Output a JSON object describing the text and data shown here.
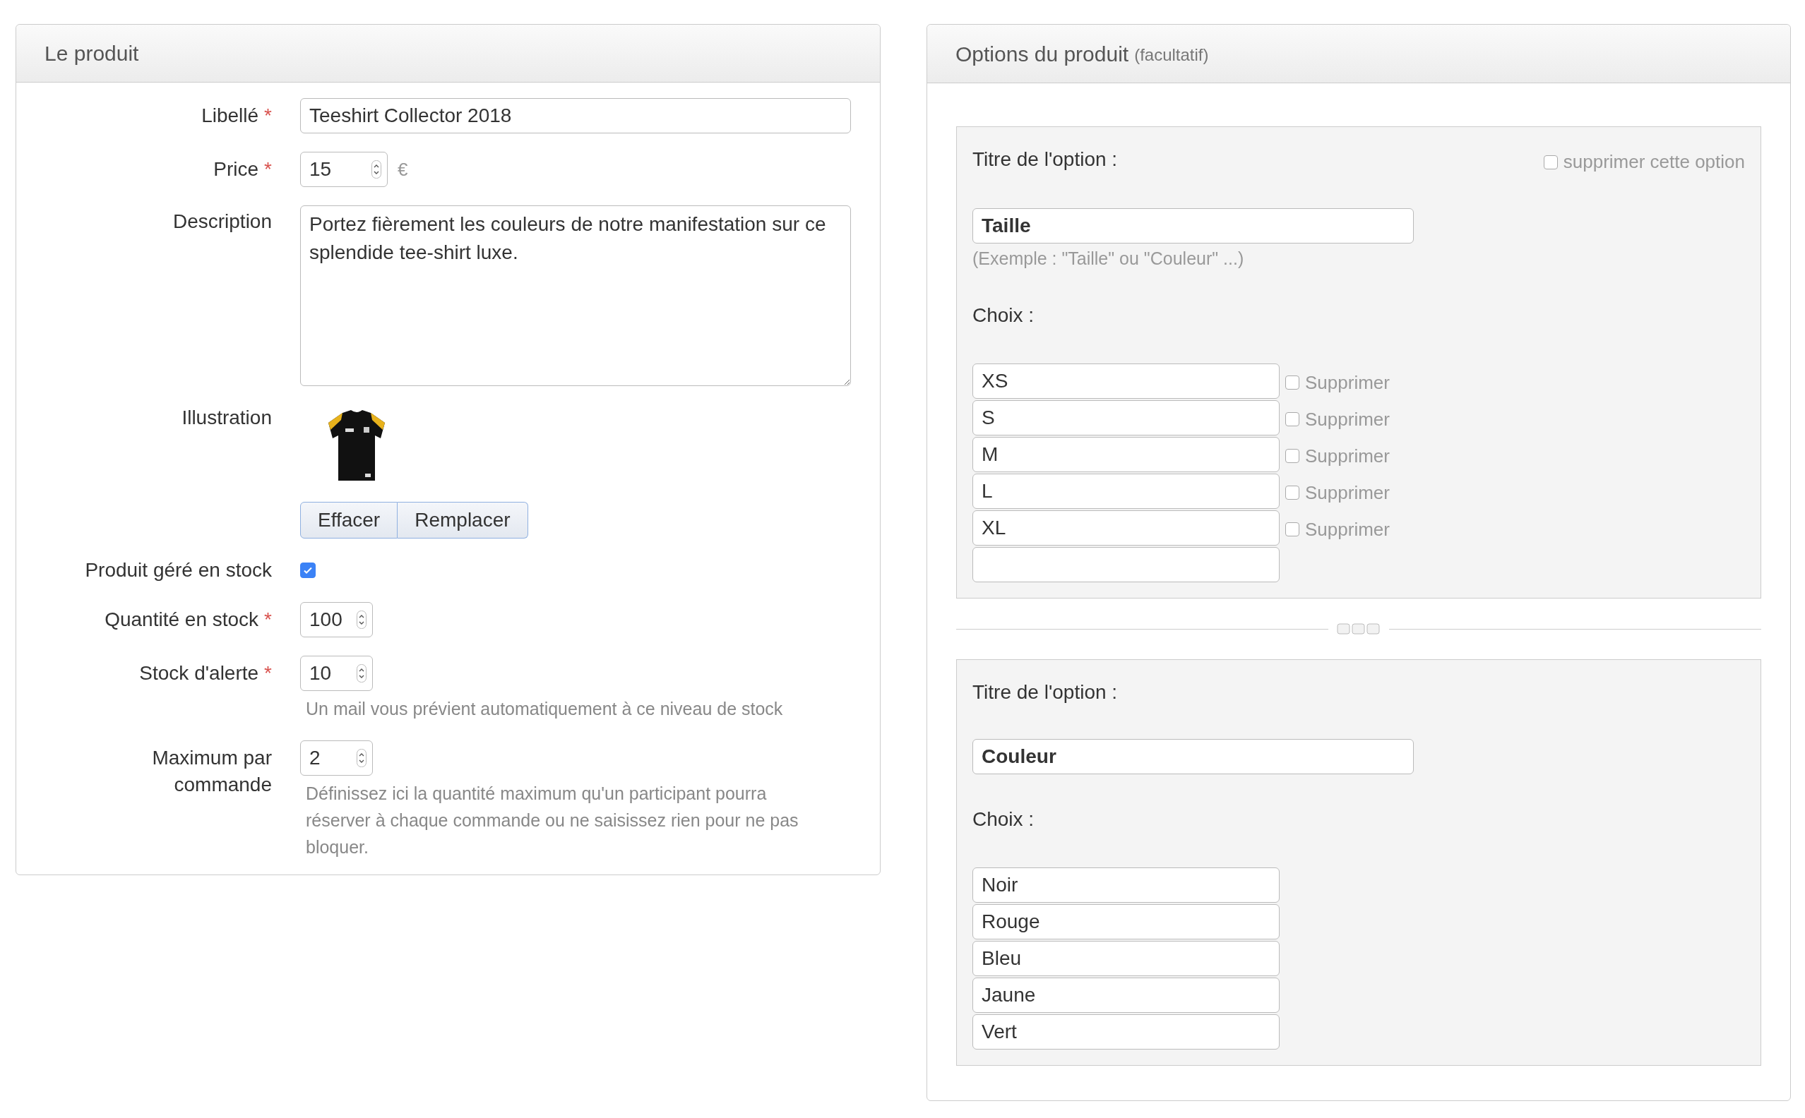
{
  "product_panel": {
    "title": "Le produit",
    "fields": [
      {
        "kind": "text",
        "label": "Libellé",
        "required_mark": "*",
        "value": "Teeshirt Collector 2018"
      },
      {
        "kind": "number",
        "label": "Price",
        "required_mark": "*",
        "value": "15",
        "unit": "€"
      },
      {
        "kind": "textarea",
        "label": "Description",
        "value": "Portez fièrement les couleurs de notre manifestation sur ce splendide tee-shirt luxe."
      },
      {
        "label": "Illustration",
        "buttons": [
          "Effacer",
          "Remplacer"
        ]
      },
      {
        "kind": "checkbox",
        "label": "Produit géré en stock",
        "checked": true
      },
      {
        "kind": "number",
        "label": "Quantité en stock",
        "required_mark": "*",
        "value": "100"
      },
      {
        "kind": "number",
        "label": "Stock d'alerte",
        "required_mark": "*",
        "value": "10",
        "hint": "Un mail vous prévient automatiquement à ce niveau de stock"
      },
      {
        "kind": "number",
        "label": "Maximum par commande",
        "value": "2",
        "hint": "Définissez ici la quantité maximum qu'un participant pourra réserver à chaque commande ou ne saisissez rien pour ne pas bloquer."
      }
    ]
  },
  "options_panel": {
    "title": "Options du produit",
    "subtitle": "(facultatif)",
    "options": [
      {
        "title_label": "Titre de l'option :",
        "delete_option": {
          "label": "supprimer cette option",
          "checked": false
        },
        "value": "Taille",
        "hint": "(Exemple : \"Taille\" ou \"Couleur\" ...)",
        "choices_label": "Choix :",
        "choices": [
          {
            "kind": "filled",
            "value": "XS",
            "delete": {
              "label": "Supprimer",
              "checked": false
            }
          },
          {
            "kind": "filled",
            "value": "S",
            "delete": {
              "label": "Supprimer",
              "checked": false
            }
          },
          {
            "kind": "filled",
            "value": "M",
            "delete": {
              "label": "Supprimer",
              "checked": false
            }
          },
          {
            "kind": "filled",
            "value": "L",
            "delete": {
              "label": "Supprimer",
              "checked": false
            }
          },
          {
            "kind": "filled",
            "value": "XL",
            "delete": {
              "label": "Supprimer",
              "checked": false
            }
          },
          {
            "kind": "new"
          }
        ]
      },
      {
        "title_label": "Titre de l'option :",
        "value": "Couleur",
        "choices_label": "Choix :",
        "choices": [
          {
            "kind": "filled",
            "value": "Noir"
          },
          {
            "kind": "filled",
            "value": "Rouge"
          },
          {
            "kind": "filled",
            "value": "Bleu"
          },
          {
            "kind": "filled",
            "value": "Jaune"
          },
          {
            "kind": "filled",
            "value": "Vert"
          }
        ]
      }
    ]
  }
}
